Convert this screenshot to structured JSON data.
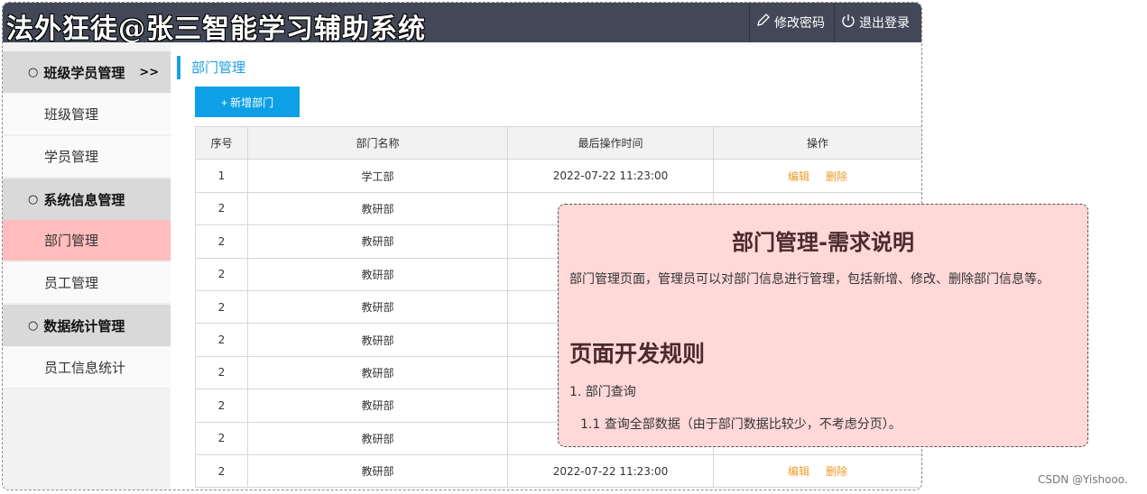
{
  "header": {
    "app_title": "法外狂徒@张三智能学习辅助系统",
    "edit_password": "修改密码",
    "logout": "退出登录"
  },
  "sidebar": {
    "groups": [
      {
        "label": "班级学员管理",
        "suffix": ">>",
        "items": [
          "班级管理",
          "学员管理"
        ]
      },
      {
        "label": "系统信息管理",
        "items": [
          "部门管理",
          "员工管理"
        ]
      },
      {
        "label": "数据统计管理",
        "items": [
          "员工信息统计"
        ]
      }
    ],
    "active_item": "部门管理"
  },
  "main": {
    "section_title": "部门管理",
    "add_button": "+ 新增部门",
    "table": {
      "headers": [
        "序号",
        "部门名称",
        "最后操作时间",
        "操作"
      ],
      "rows": [
        {
          "id": "1",
          "name": "学工部",
          "time": "2022-07-22 11:23:00",
          "edit": "编辑",
          "delete": "删除"
        },
        {
          "id": "2",
          "name": "教研部",
          "time": "",
          "edit": "",
          "delete": ""
        },
        {
          "id": "2",
          "name": "教研部",
          "time": "",
          "edit": "",
          "delete": ""
        },
        {
          "id": "2",
          "name": "教研部",
          "time": "",
          "edit": "",
          "delete": ""
        },
        {
          "id": "2",
          "name": "教研部",
          "time": "",
          "edit": "",
          "delete": ""
        },
        {
          "id": "2",
          "name": "教研部",
          "time": "",
          "edit": "",
          "delete": ""
        },
        {
          "id": "2",
          "name": "教研部",
          "time": "",
          "edit": "",
          "delete": ""
        },
        {
          "id": "2",
          "name": "教研部",
          "time": "",
          "edit": "",
          "delete": ""
        },
        {
          "id": "2",
          "name": "教研部",
          "time": "",
          "edit": "",
          "delete": ""
        },
        {
          "id": "2",
          "name": "教研部",
          "time": "2022-07-22 11:23:00",
          "edit": "编辑",
          "delete": "删除"
        }
      ]
    }
  },
  "note": {
    "title": "部门管理-需求说明",
    "description": "部门管理页面，管理员可以对部门信息进行管理，包括新增、修改、删除部门信息等。",
    "rules_heading": "页面开发规则",
    "rule_1": "1. 部门查询",
    "rule_1_1": "1.1  查询全部数据（由于部门数据比较少，不考虑分页）。"
  },
  "watermark": "CSDN @Yishooo.",
  "colors": {
    "topbar": "#434859",
    "accent": "#0ea0e6",
    "active_item": "#ffbdbd",
    "note_bg": "#ffd8d8",
    "op_link": "#ef9a2a"
  }
}
